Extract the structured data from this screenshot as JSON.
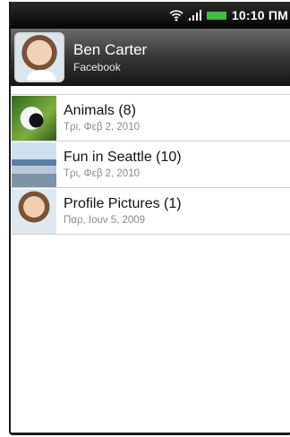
{
  "status_bar": {
    "time": "10:10 ΠΜ",
    "icons": [
      "wifi-icon",
      "signal-icon",
      "battery-icon"
    ],
    "battery_color": "#3fbf3f"
  },
  "account": {
    "name": "Ben Carter",
    "source": "Facebook"
  },
  "albums": [
    {
      "title": "Animals (8)",
      "date": "Τρι, Φεβ 2, 2010",
      "thumb": "animals"
    },
    {
      "title": "Fun in Seattle  (10)",
      "date": "Τρι, Φεβ 2, 2010",
      "thumb": "seattle"
    },
    {
      "title": "Profile Pictures (1)",
      "date": "Παρ, Ιουν 5, 2009",
      "thumb": "profile"
    }
  ]
}
